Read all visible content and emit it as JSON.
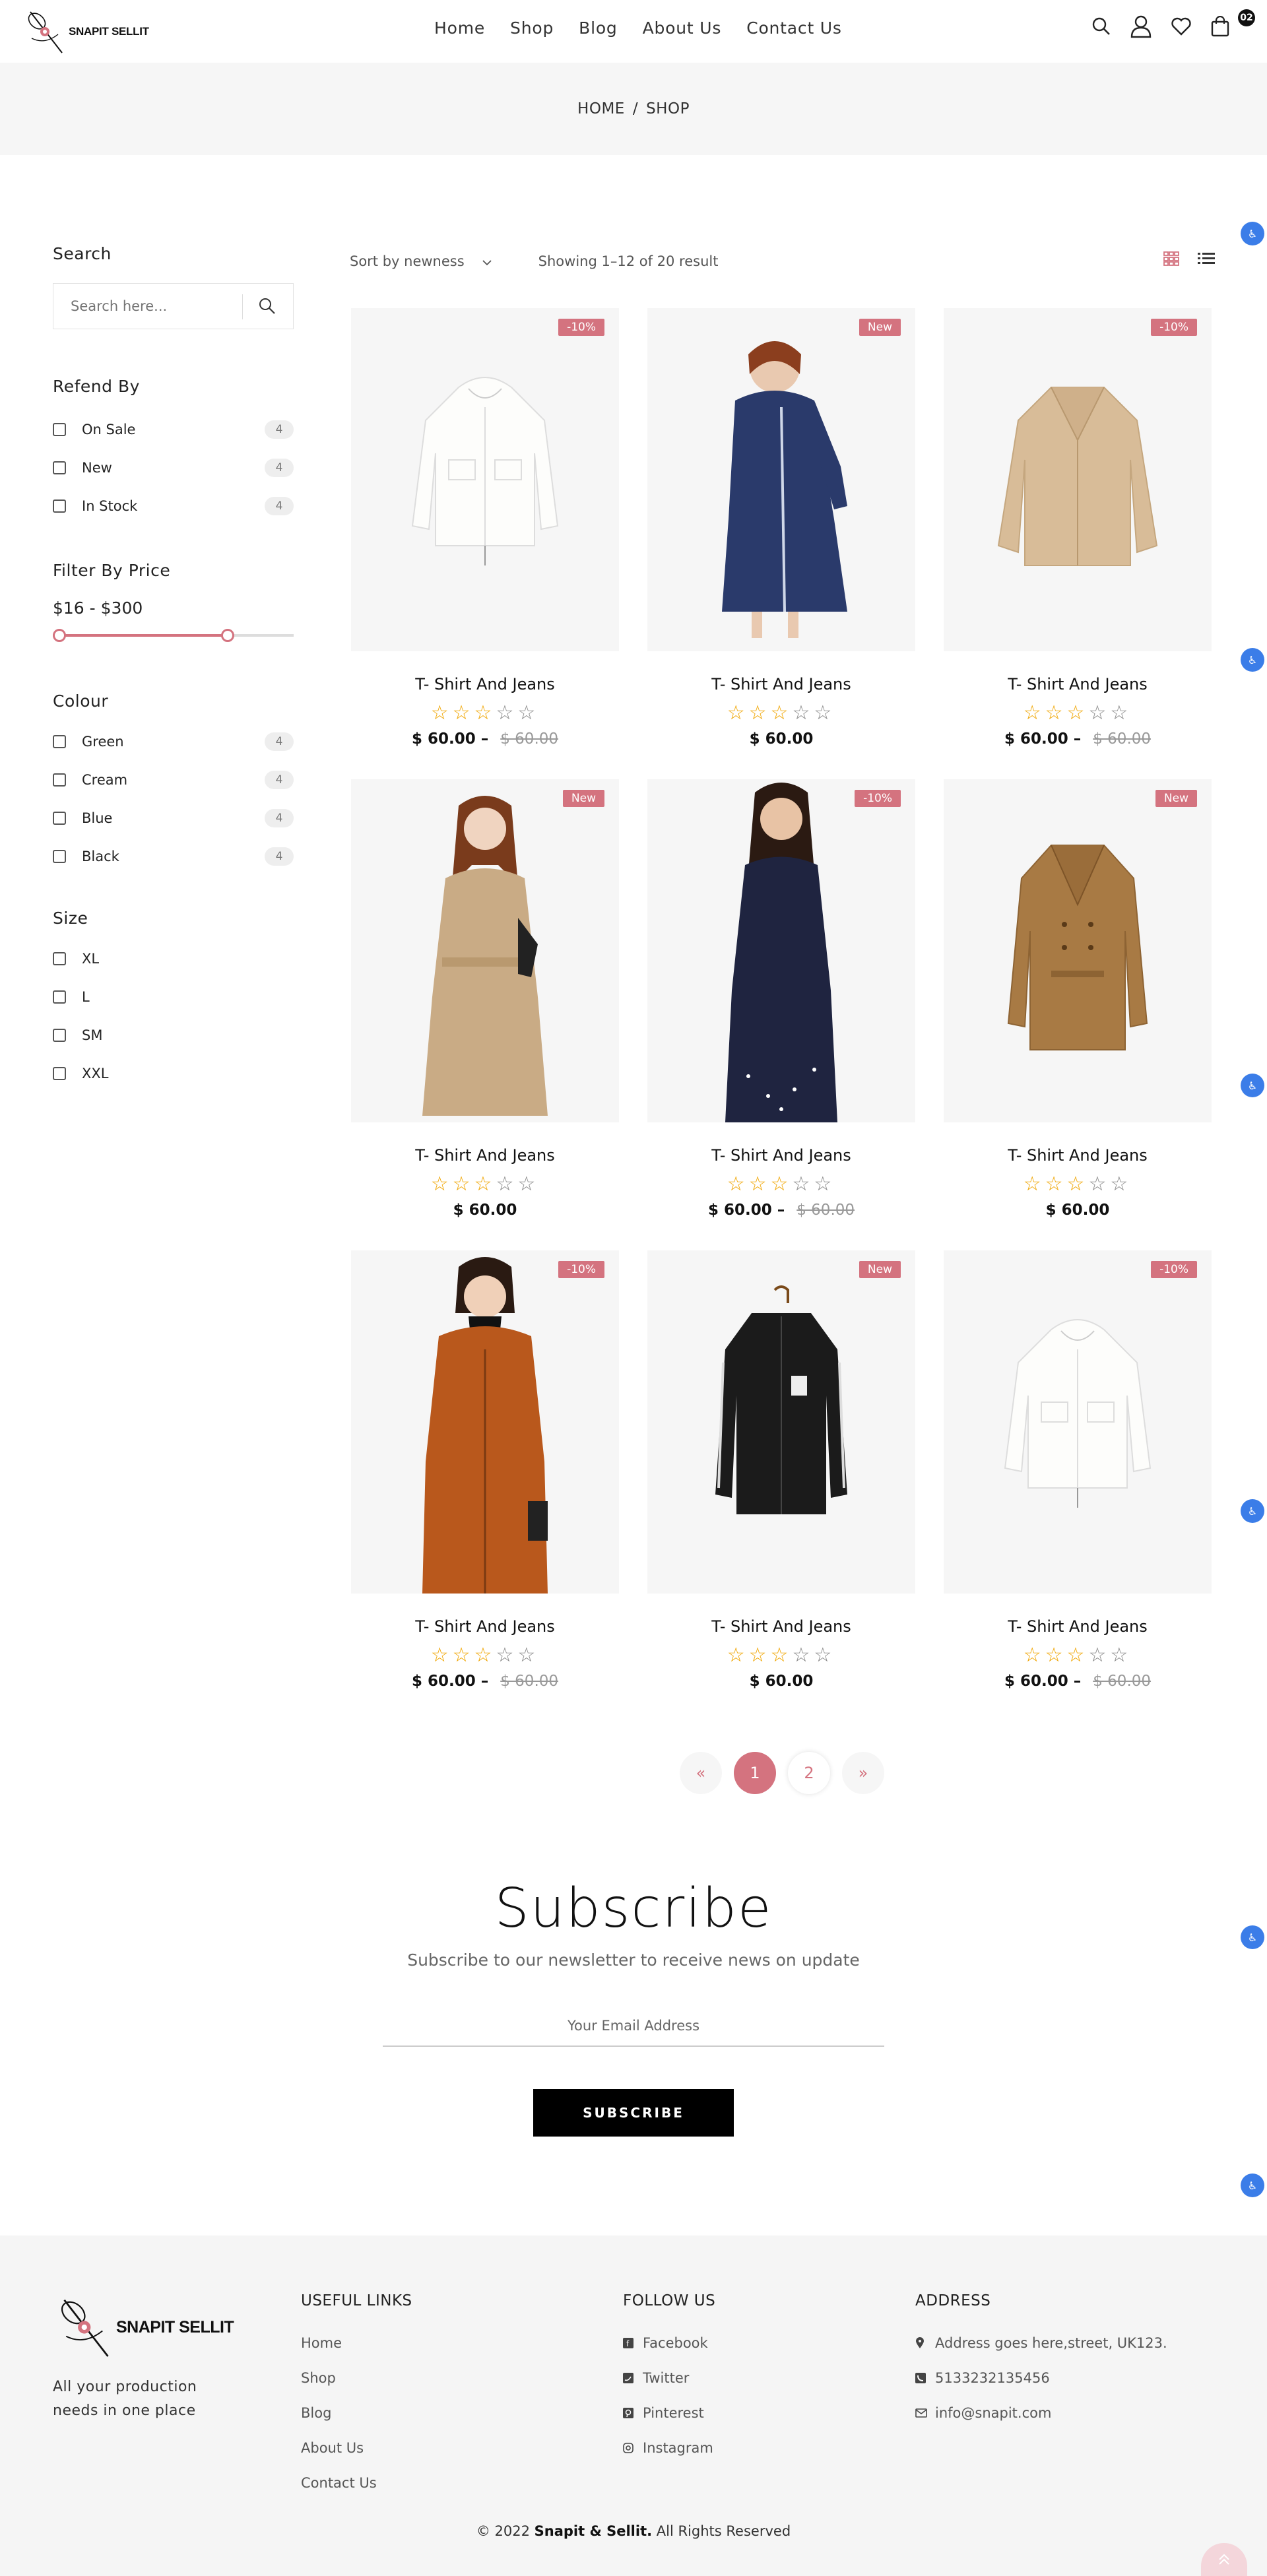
{
  "brand": {
    "name": "SNAPIT SELLIT"
  },
  "nav": {
    "items": [
      "Home",
      "Shop",
      "Blog",
      "About Us",
      "Contact Us"
    ]
  },
  "header": {
    "cart_count": "02"
  },
  "breadcrumb": {
    "home": "HOME",
    "sep": "/",
    "current": "SHOP"
  },
  "sidebar": {
    "search_title": "Search",
    "search_placeholder": "Search here...",
    "refine_title": "Refend By",
    "refine": [
      {
        "label": "On Sale",
        "count": "4"
      },
      {
        "label": "New",
        "count": "4"
      },
      {
        "label": "In Stock",
        "count": "4"
      }
    ],
    "price_title": "Filter By Price",
    "price_range": "$16 - $300",
    "price_min_frac": 0.0,
    "price_max_frac": 0.74,
    "colour_title": "Colour",
    "colours": [
      {
        "label": "Green",
        "count": "4"
      },
      {
        "label": "Cream",
        "count": "4"
      },
      {
        "label": "Blue",
        "count": "4"
      },
      {
        "label": "Black",
        "count": "4"
      }
    ],
    "size_title": "Size",
    "sizes": [
      "XL",
      "L",
      "SM",
      "XXL"
    ]
  },
  "toolbar": {
    "sort_label": "Sort by newness",
    "showing": "Showing 1–12 of 20 result"
  },
  "products": [
    {
      "title": "T- Shirt And Jeans",
      "badge": "-10%",
      "rating": 3,
      "price": "$ 60.00",
      "old_price": "$ 60.00",
      "image": "white-jacket"
    },
    {
      "title": "T- Shirt And Jeans",
      "badge": "New",
      "rating": 3,
      "price": "$ 60.00",
      "old_price": "",
      "image": "denim-coat"
    },
    {
      "title": "T- Shirt And Jeans",
      "badge": "-10%",
      "rating": 3,
      "price": "$ 60.00",
      "old_price": "$ 60.00",
      "image": "beige-teddy-coat"
    },
    {
      "title": "T- Shirt And Jeans",
      "badge": "New",
      "rating": 3,
      "price": "$ 60.00",
      "old_price": "",
      "image": "beige-trench-model"
    },
    {
      "title": "T- Shirt And Jeans",
      "badge": "-10%",
      "rating": 3,
      "price": "$ 60.00",
      "old_price": "$ 60.00",
      "image": "navy-dress"
    },
    {
      "title": "T- Shirt And Jeans",
      "badge": "New",
      "rating": 3,
      "price": "$ 60.00",
      "old_price": "",
      "image": "camel-trench"
    },
    {
      "title": "T- Shirt And Jeans",
      "badge": "-10%",
      "rating": 3,
      "price": "$ 60.00",
      "old_price": "$ 60.00",
      "image": "orange-hoodie-coat"
    },
    {
      "title": "T- Shirt And Jeans",
      "badge": "New",
      "rating": 3,
      "price": "$ 60.00",
      "old_price": "",
      "image": "black-parka"
    },
    {
      "title": "T- Shirt And Jeans",
      "badge": "-10%",
      "rating": 3,
      "price": "$ 60.00",
      "old_price": "$ 60.00",
      "image": "white-jacket"
    }
  ],
  "pagination": {
    "prev": "«",
    "pages": [
      "1",
      "2"
    ],
    "active": "1",
    "next": "»"
  },
  "subscribe": {
    "title": "Subscribe",
    "text": "Subscribe to our newsletter to receive news on update",
    "placeholder": "Your Email Address",
    "button": "SUBSCRIBE"
  },
  "footer": {
    "tagline": "All your production needs in one place",
    "useful_title": "USEFUL LINKS",
    "useful_links": [
      "Home",
      "Shop",
      "Blog",
      "About Us",
      "Contact Us"
    ],
    "follow_title": "FOLLOW US",
    "follow_links": [
      {
        "label": "Facebook",
        "icon": "facebook-icon"
      },
      {
        "label": "Twitter",
        "icon": "twitter-icon"
      },
      {
        "label": "Pinterest",
        "icon": "pinterest-icon"
      },
      {
        "label": "Instagram",
        "icon": "instagram-icon"
      }
    ],
    "address_title": "ADDRESS",
    "address": [
      {
        "label": "Address goes here,street, UK123.",
        "icon": "map-pin-icon"
      },
      {
        "label": "5133232135456",
        "icon": "phone-icon"
      },
      {
        "label": "info@snapit.com",
        "icon": "mail-icon"
      }
    ],
    "copyright_pre": "© 2022",
    "copyright_brand": "Snapit & Sellit.",
    "copyright_post": "All Rights Reserved"
  },
  "colors": {
    "accent": "#d4737f",
    "star": "#f0a500",
    "band": "#f6f6f6",
    "footer_bg": "#f5f5f5"
  }
}
